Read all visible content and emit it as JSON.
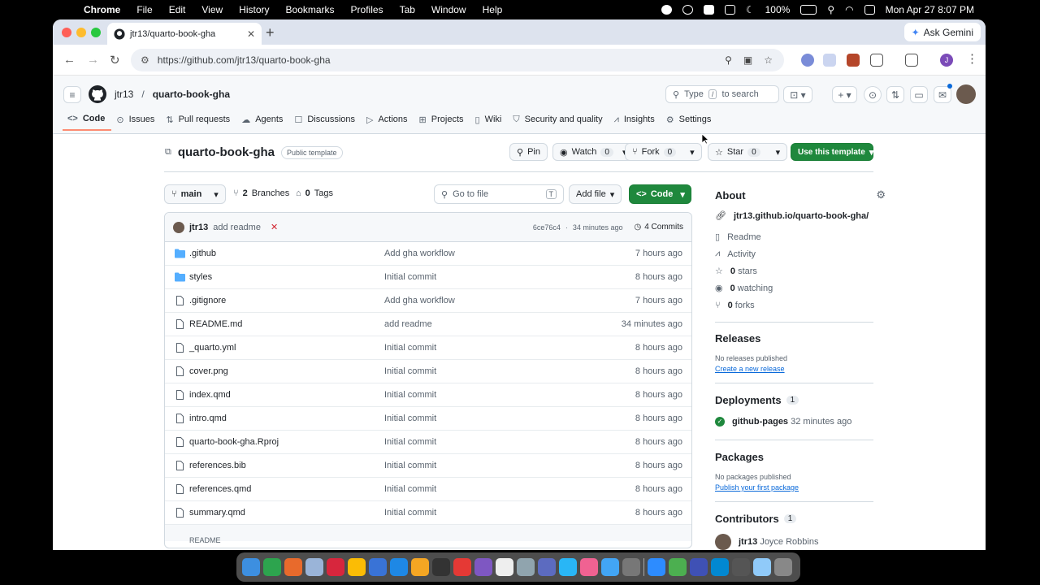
{
  "menubar": {
    "app": "Chrome",
    "items": [
      "File",
      "Edit",
      "View",
      "History",
      "Bookmarks",
      "Profiles",
      "Tab",
      "Window",
      "Help"
    ],
    "battery": "100%",
    "datetime": "Mon Apr 27  8:07 PM"
  },
  "browser": {
    "tab_title": "jtr13/quarto-book-gha",
    "url": "https://github.com/jtr13/quarto-book-gha",
    "gemini_label": "Ask Gemini",
    "profile_initial": "J"
  },
  "github": {
    "owner": "jtr13",
    "repo": "quarto-book-gha",
    "search_prefix": "Type",
    "search_key": "/",
    "search_suffix": "to search",
    "nav": [
      {
        "label": "Code",
        "icon": "code-icon"
      },
      {
        "label": "Issues",
        "icon": "issue-icon"
      },
      {
        "label": "Pull requests",
        "icon": "pull-request-icon"
      },
      {
        "label": "Agents",
        "icon": "agents-icon"
      },
      {
        "label": "Discussions",
        "icon": "discussions-icon"
      },
      {
        "label": "Actions",
        "icon": "actions-icon"
      },
      {
        "label": "Projects",
        "icon": "projects-icon"
      },
      {
        "label": "Wiki",
        "icon": "wiki-icon"
      },
      {
        "label": "Security and quality",
        "icon": "shield-icon"
      },
      {
        "label": "Insights",
        "icon": "graph-icon"
      },
      {
        "label": "Settings",
        "icon": "gear-icon"
      }
    ]
  },
  "repo": {
    "title": "quarto-book-gha",
    "visibility": "Public template",
    "pin": "Pin",
    "watch": "Watch",
    "watch_count": "0",
    "fork": "Fork",
    "fork_count": "0",
    "star": "Star",
    "star_count": "0",
    "use_template": "Use this template",
    "branch": "main",
    "branches_count": "2",
    "branches_label": "Branches",
    "tags_count": "0",
    "tags_label": "Tags",
    "goto_placeholder": "Go to file",
    "goto_key": "T",
    "add_file": "Add file",
    "code_btn": "Code"
  },
  "commit": {
    "author": "jtr13",
    "message": "add readme",
    "status": "✕",
    "sha": "6ce76c4",
    "time": "34 minutes ago",
    "commits_label": "4 Commits"
  },
  "files": [
    {
      "name": ".github",
      "type": "dir",
      "message": "Add gha workflow",
      "time": "7 hours ago"
    },
    {
      "name": "styles",
      "type": "dir",
      "message": "Initial commit",
      "time": "8 hours ago"
    },
    {
      "name": ".gitignore",
      "type": "file",
      "message": "Add gha workflow",
      "time": "7 hours ago"
    },
    {
      "name": "README.md",
      "type": "file",
      "message": "add readme",
      "time": "34 minutes ago"
    },
    {
      "name": "_quarto.yml",
      "type": "file",
      "message": "Initial commit",
      "time": "8 hours ago"
    },
    {
      "name": "cover.png",
      "type": "file",
      "message": "Initial commit",
      "time": "8 hours ago"
    },
    {
      "name": "index.qmd",
      "type": "file",
      "message": "Initial commit",
      "time": "8 hours ago"
    },
    {
      "name": "intro.qmd",
      "type": "file",
      "message": "Initial commit",
      "time": "8 hours ago"
    },
    {
      "name": "quarto-book-gha.Rproj",
      "type": "file",
      "message": "Initial commit",
      "time": "8 hours ago"
    },
    {
      "name": "references.bib",
      "type": "file",
      "message": "Initial commit",
      "time": "8 hours ago"
    },
    {
      "name": "references.qmd",
      "type": "file",
      "message": "Initial commit",
      "time": "8 hours ago"
    },
    {
      "name": "summary.qmd",
      "type": "file",
      "message": "Initial commit",
      "time": "8 hours ago"
    }
  ],
  "readme_header": "README",
  "about": {
    "heading": "About",
    "link": "jtr13.github.io/quarto-book-gha/",
    "readme": "Readme",
    "activity": "Activity",
    "stars_count": "0",
    "stars_label": "stars",
    "watching_count": "0",
    "watching_label": "watching",
    "forks_count": "0",
    "forks_label": "forks"
  },
  "releases": {
    "heading": "Releases",
    "none": "No releases published",
    "create": "Create a new release"
  },
  "deployments": {
    "heading": "Deployments",
    "count": "1",
    "name": "github-pages",
    "time": "32 minutes ago"
  },
  "packages": {
    "heading": "Packages",
    "none": "No packages published",
    "publish": "Publish your first package"
  },
  "contributors": {
    "heading": "Contributors",
    "count": "1",
    "user": "jtr13",
    "name": "Joyce Robbins"
  },
  "colors": {
    "accent_blue": "#0969da",
    "green": "#1f883d",
    "folder": "#54aeff",
    "nav_underline": "#fd8c73"
  }
}
